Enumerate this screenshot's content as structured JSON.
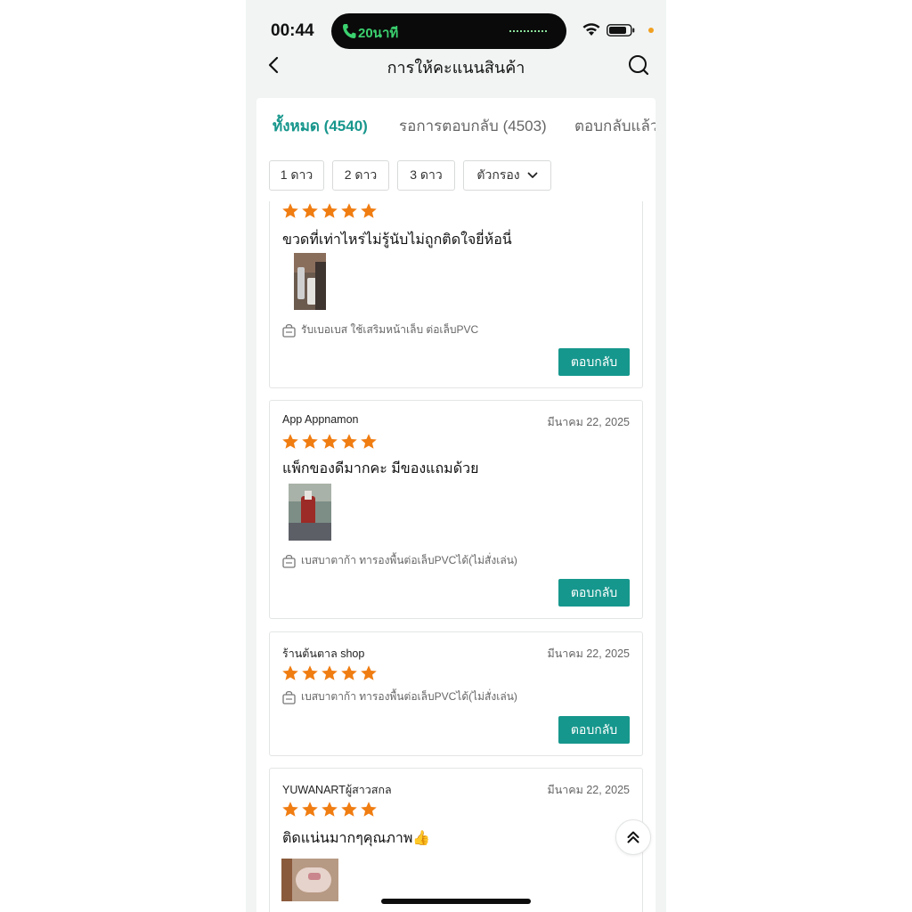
{
  "status_bar": {
    "time": "00:44",
    "call_label": "20นาที"
  },
  "header": {
    "title": "การให้คะแนนสินค้า"
  },
  "tabs": [
    {
      "label": "ทั้งหมด (4540)",
      "active": true
    },
    {
      "label": "รอการตอบกลับ (4503)",
      "active": false
    },
    {
      "label": "ตอบกลับแล้ว",
      "active": false
    }
  ],
  "filters": [
    {
      "label": "1 ดาว"
    },
    {
      "label": "2 ดาว"
    },
    {
      "label": "3 ดาว"
    },
    {
      "label": "ตัวกรอง",
      "icon": "chevron-down-icon"
    }
  ],
  "colors": {
    "accent": "#16978d",
    "star": "#f07d12"
  },
  "reviews": [
    {
      "reviewer": "",
      "date": "",
      "stars": 5,
      "comment": "ขวดที่เท่าไหร่ไม่รู้นับไม่ถูกติดใจยี่ห้อนี่",
      "product": "รับเบอเบส ใช้เสริมหน้าเล็บ ต่อเล็บPVC",
      "reply_label": "ตอบกลับ"
    },
    {
      "reviewer": "App Appnamon",
      "date": "มีนาคม 22, 2025",
      "stars": 5,
      "comment": "แพ็กของดีมากคะ มีของแถมด้วย",
      "product": "เบสบาตาก้า ทารองพื้นต่อเล็บPVCได้(ไม่สั่งเล่น)",
      "reply_label": "ตอบกลับ"
    },
    {
      "reviewer": "ร้านต้นตาล shop",
      "date": "มีนาคม 22, 2025",
      "stars": 5,
      "comment": "",
      "product": "เบสบาตาก้า ทารองพื้นต่อเล็บPVCได้(ไม่สั่งเล่น)",
      "reply_label": "ตอบกลับ"
    },
    {
      "reviewer": "YUWANARTผู้สาวสกล",
      "date": "มีนาคม 22, 2025",
      "stars": 5,
      "comment": "ติดแน่นมากๆคุณภาพ👍",
      "product": "",
      "reply_label": ""
    }
  ]
}
